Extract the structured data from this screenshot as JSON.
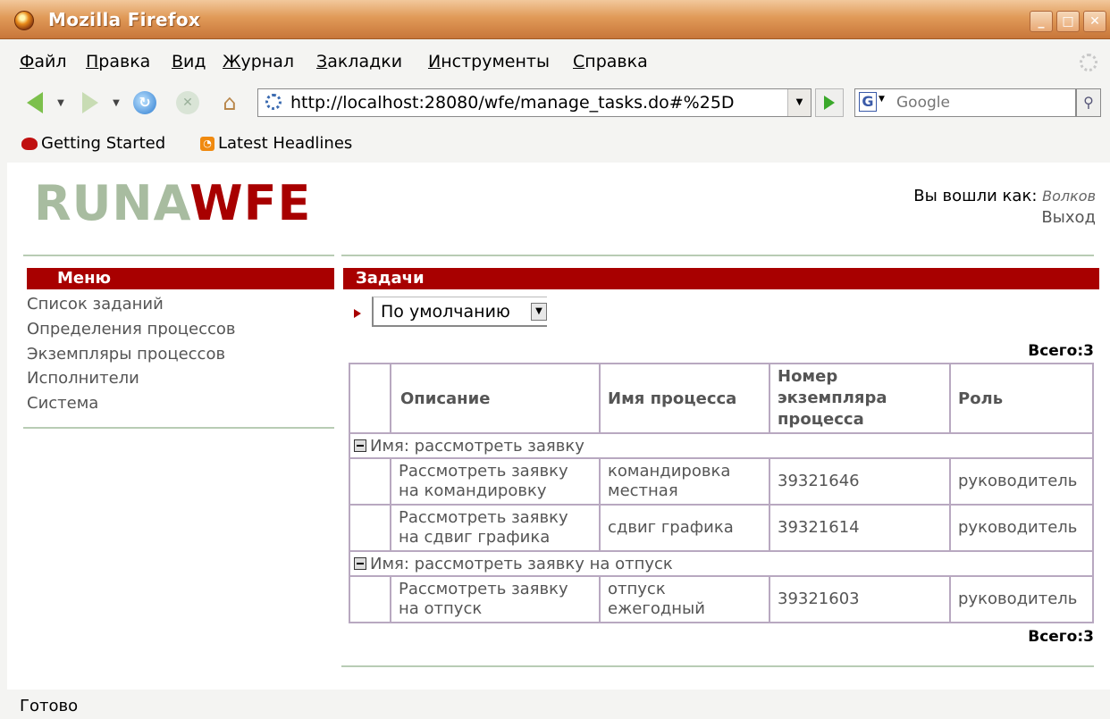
{
  "window": {
    "title": "Mozilla Firefox"
  },
  "menubar": [
    {
      "accel": "Ф",
      "rest": "айл"
    },
    {
      "accel": "П",
      "rest": "равка"
    },
    {
      "accel": "В",
      "rest": "ид"
    },
    {
      "accel": "Ж",
      "rest": "урнал"
    },
    {
      "accel": "З",
      "rest": "акладки"
    },
    {
      "accel": "И",
      "rest": "нструменты"
    },
    {
      "accel": "С",
      "rest": "правка"
    }
  ],
  "nav": {
    "url": "http://localhost:28080/wfe/manage_tasks.do#%25D",
    "search_placeholder": "Google"
  },
  "bookmarks": [
    "Getting Started",
    "Latest Headlines"
  ],
  "header": {
    "logo_part1": "RUNA",
    "logo_part2": "WFE",
    "logged_in_label": "Вы вошли как:",
    "username": "Волков",
    "logout": "Выход"
  },
  "menu": {
    "title": "Меню",
    "items": [
      "Список заданий",
      "Определения процессов",
      "Экземпляры процессов",
      "Исполнители",
      "Система"
    ]
  },
  "tasks": {
    "title": "Задачи",
    "filter_value": "По умолчанию",
    "total_label": "Всего:3",
    "columns": [
      "Описание",
      "Имя процесса",
      "Номер экземпляра процесса",
      "Роль"
    ],
    "groups": [
      {
        "label": "Имя: рассмотреть заявку",
        "rows": [
          {
            "desc": "Рассмотреть заявку на командировку",
            "process": "командировка местная",
            "number": "39321646",
            "role": "руководитель"
          },
          {
            "desc": "Рассмотреть заявку на сдвиг графика",
            "process": "сдвиг графика",
            "number": "39321614",
            "role": "руководитель"
          }
        ]
      },
      {
        "label": "Имя: рассмотреть заявку на отпуск",
        "rows": [
          {
            "desc": "Рассмотреть заявку на отпуск",
            "process": "отпуск ежегодный",
            "number": "39321603",
            "role": "руководитель"
          }
        ]
      }
    ]
  },
  "status": {
    "text": "Готово"
  },
  "colors": {
    "brand_red": "#a80000",
    "logo_green": "#a8bca0",
    "table_border": "#b8a8c0"
  }
}
